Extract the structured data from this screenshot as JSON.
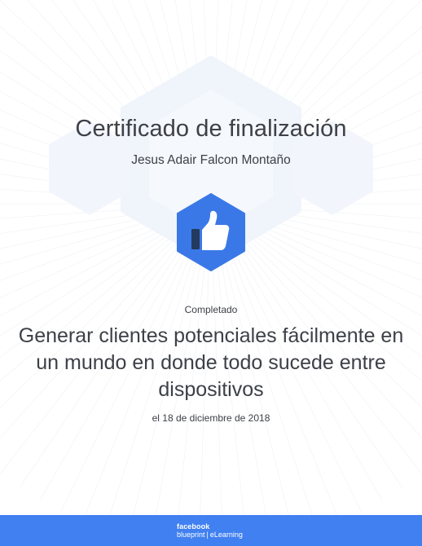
{
  "certificate": {
    "title": "Certificado de finalización",
    "recipient": "Jesus Adair Falcon Montaño",
    "completed_label": "Completado",
    "course_title": "Generar clientes potenciales fácilmente en un mundo en donde todo sucede entre dispositivos",
    "date": "el 18 de diciembre de 2018",
    "badge_icon": "thumbs-up-icon"
  },
  "footer": {
    "brand": "facebook",
    "product_left": "blueprint",
    "separator": "|",
    "product_right": "eLearning"
  },
  "colors": {
    "accent": "#4080f0",
    "badge": "#3b78e7",
    "text": "#3d4047"
  }
}
